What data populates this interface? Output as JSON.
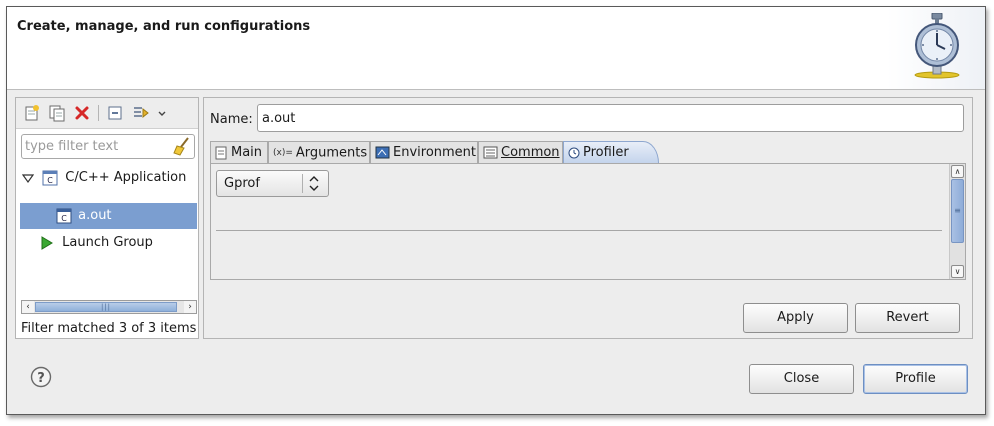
{
  "window": {
    "banner_title": "Create, manage, and run configurations",
    "banner_icon": "stopwatch-icon"
  },
  "left": {
    "toolbar": [
      {
        "name": "new-configuration-icon"
      },
      {
        "name": "duplicate-icon"
      },
      {
        "name": "delete-icon"
      },
      {
        "name": "collapse-all-icon"
      },
      {
        "name": "filter-configurations-icon"
      },
      {
        "name": "view-menu-chevron-icon"
      }
    ],
    "filter": {
      "placeholder": "type filter text",
      "value": ""
    },
    "tree": [
      {
        "label": "C/C++ Application",
        "level": 0,
        "expanded": true,
        "selected": false,
        "icon": "c-app-icon"
      },
      {
        "label": "a.out",
        "level": 1,
        "selected": true,
        "icon": "c-file-icon"
      },
      {
        "label": "Launch Group",
        "level": 0,
        "selected": false,
        "icon": "launch-group-icon"
      }
    ],
    "status": "Filter matched 3 of 3 items"
  },
  "right": {
    "name_label": "Name:",
    "name_value": "a.out",
    "tabs": [
      {
        "label": "Main",
        "icon": "main-page-icon",
        "active": false
      },
      {
        "label": "Arguments",
        "icon": "variables-icon",
        "active": false
      },
      {
        "label": "Environment",
        "icon": "environment-icon",
        "active": false
      },
      {
        "label": "Common",
        "icon": "common-icon",
        "active": false
      },
      {
        "label": "Profiler",
        "icon": "clock-icon",
        "active": true
      }
    ],
    "profiler_select": {
      "value": "Gprof"
    },
    "apply_label": "Apply",
    "revert_label": "Revert"
  },
  "footer": {
    "close_label": "Close",
    "profile_label": "Profile",
    "help_icon": "help-icon"
  },
  "colors": {
    "selection": "#7b9ed0",
    "dialog_bg": "#ededed",
    "active_tab": "#c4d4ec",
    "delete_red": "#d62828",
    "launch_green": "#3aa832"
  }
}
